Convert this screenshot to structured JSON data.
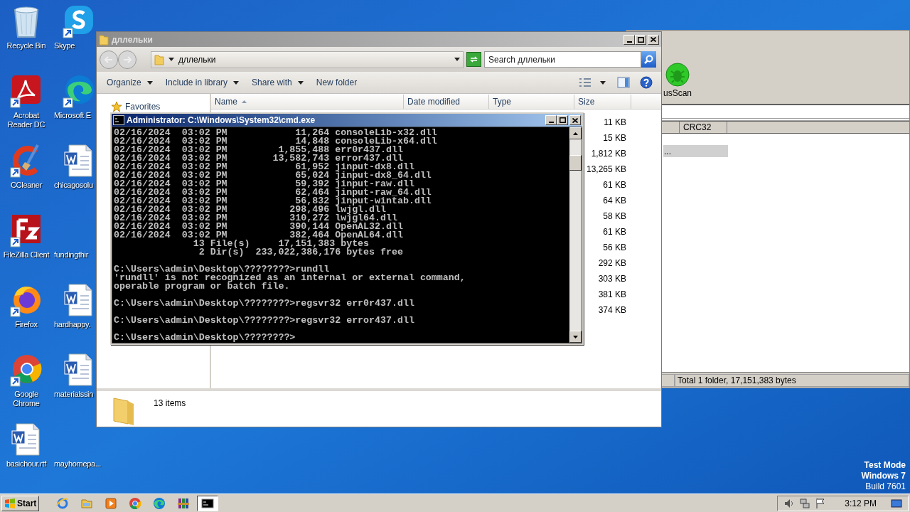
{
  "desktop_icons": [
    {
      "label": "Recycle Bin",
      "kind": "recycle",
      "shortcut": false
    },
    {
      "label": "Skype",
      "kind": "skype",
      "shortcut": true
    },
    {
      "label": "Acrobat\nReader DC",
      "kind": "acrobat",
      "shortcut": true
    },
    {
      "label": "Microsoft E",
      "kind": "edge",
      "shortcut": true
    },
    {
      "label": "CCleaner",
      "kind": "ccleaner",
      "shortcut": true
    },
    {
      "label": "chicagosolu",
      "kind": "word",
      "shortcut": false
    },
    {
      "label": "FileZilla Client",
      "kind": "filezilla",
      "shortcut": true
    },
    {
      "label": "fundingthir",
      "kind": "blank",
      "shortcut": false
    },
    {
      "label": "Firefox",
      "kind": "firefox",
      "shortcut": true
    },
    {
      "label": "hardhappy.",
      "kind": "word",
      "shortcut": false
    },
    {
      "label": "Google\nChrome",
      "kind": "chrome",
      "shortcut": true
    },
    {
      "label": "materialssin",
      "kind": "word",
      "shortcut": false
    },
    {
      "label": "basichour.rtf",
      "kind": "word",
      "shortcut": false
    },
    {
      "label": "mayhomepa...",
      "kind": "blank",
      "shortcut": false
    }
  ],
  "background_window": {
    "toolbar_label": "usScan",
    "column_2": "CRC32",
    "rows": [
      {
        "text": "...",
        "selected": true
      }
    ],
    "status": "Total 1 folder, 17,151,383 bytes"
  },
  "explorer": {
    "title": "дллельки",
    "address": "дллельки",
    "search": {
      "placeholder": "Search дллельки"
    },
    "toolbar": [
      {
        "label": "Organize",
        "dropdown": true
      },
      {
        "label": "Include in library",
        "dropdown": true
      },
      {
        "label": "Share with",
        "dropdown": true
      },
      {
        "label": "New folder",
        "dropdown": false
      }
    ],
    "nav": [
      {
        "label": "Favorites"
      }
    ],
    "columns": [
      {
        "label": "Name",
        "sorted": true
      },
      {
        "label": "Date modified",
        "sorted": false
      },
      {
        "label": "Type",
        "sorted": false
      },
      {
        "label": "Size",
        "sorted": false
      }
    ],
    "rows": [
      {
        "size": "11 KB"
      },
      {
        "size": "15 KB"
      },
      {
        "size": "1,812 KB"
      },
      {
        "size": "13,265 KB"
      },
      {
        "size": "61 KB"
      },
      {
        "size": "64 KB"
      },
      {
        "size": "58 KB"
      },
      {
        "size": "61 KB"
      },
      {
        "size": "56 KB"
      },
      {
        "size": "292 KB"
      },
      {
        "size": "303 KB"
      },
      {
        "size": "381 KB"
      },
      {
        "size": "374 KB"
      }
    ],
    "details": "13 items"
  },
  "cmd": {
    "title": "Administrator: C:\\Windows\\System32\\cmd.exe",
    "blocks": [
      {
        "lines": [
          "02/16/2024  03:02 PM            11,264 consoleLib-x32.dll",
          "02/16/2024  03:02 PM            14,848 consoleLib-x64.dll",
          "02/16/2024  03:02 PM         1,855,488 err0r437.dll",
          "02/16/2024  03:02 PM        13,582,743 error437.dll",
          "02/16/2024  03:02 PM            61,952 jinput-dx8.dll",
          "02/16/2024  03:02 PM            65,024 jinput-dx8_64.dll",
          "02/16/2024  03:02 PM            59,392 jinput-raw.dll",
          "02/16/2024  03:02 PM            62,464 jinput-raw_64.dll",
          "02/16/2024  03:02 PM            56,832 jinput-wintab.dll",
          "02/16/2024  03:02 PM           298,496 lwjgl.dll",
          "02/16/2024  03:02 PM           310,272 lwjgl64.dll",
          "02/16/2024  03:02 PM           390,144 OpenAL32.dll",
          "02/16/2024  03:02 PM           382,464 OpenAL64.dll",
          "              13 File(s)     17,151,383 bytes",
          "               2 Dir(s)  233,022,386,176 bytes free"
        ]
      },
      {
        "lines": [
          "C:\\Users\\admin\\Desktop\\????????>rundll",
          "'rundll' is not recognized as an internal or external command,",
          "operable program or batch file."
        ]
      },
      {
        "lines": [
          "C:\\Users\\admin\\Desktop\\????????>regsvr32 err0r437.dll"
        ]
      },
      {
        "lines": [
          "C:\\Users\\admin\\Desktop\\????????>regsvr32 error437.dll"
        ]
      },
      {
        "lines": [
          "C:\\Users\\admin\\Desktop\\????????>"
        ]
      }
    ]
  },
  "system_notice": [
    {
      "text": "Test Mode",
      "bold": true
    },
    {
      "text": "Windows 7",
      "bold": true
    },
    {
      "text": "Build 7601",
      "bold": false
    }
  ],
  "taskbar": {
    "start": "Start",
    "apps": [
      {
        "kind": "ie",
        "active": false
      },
      {
        "kind": "explorer",
        "active": false
      },
      {
        "kind": "media",
        "active": false
      },
      {
        "kind": "chrome",
        "active": false
      },
      {
        "kind": "edge",
        "active": false
      },
      {
        "kind": "winrar",
        "active": false
      },
      {
        "kind": "cmd",
        "active": true
      }
    ],
    "tray": [
      {
        "kind": "speaker"
      },
      {
        "kind": "network"
      },
      {
        "kind": "flag"
      }
    ],
    "clock": "3:12 PM"
  }
}
